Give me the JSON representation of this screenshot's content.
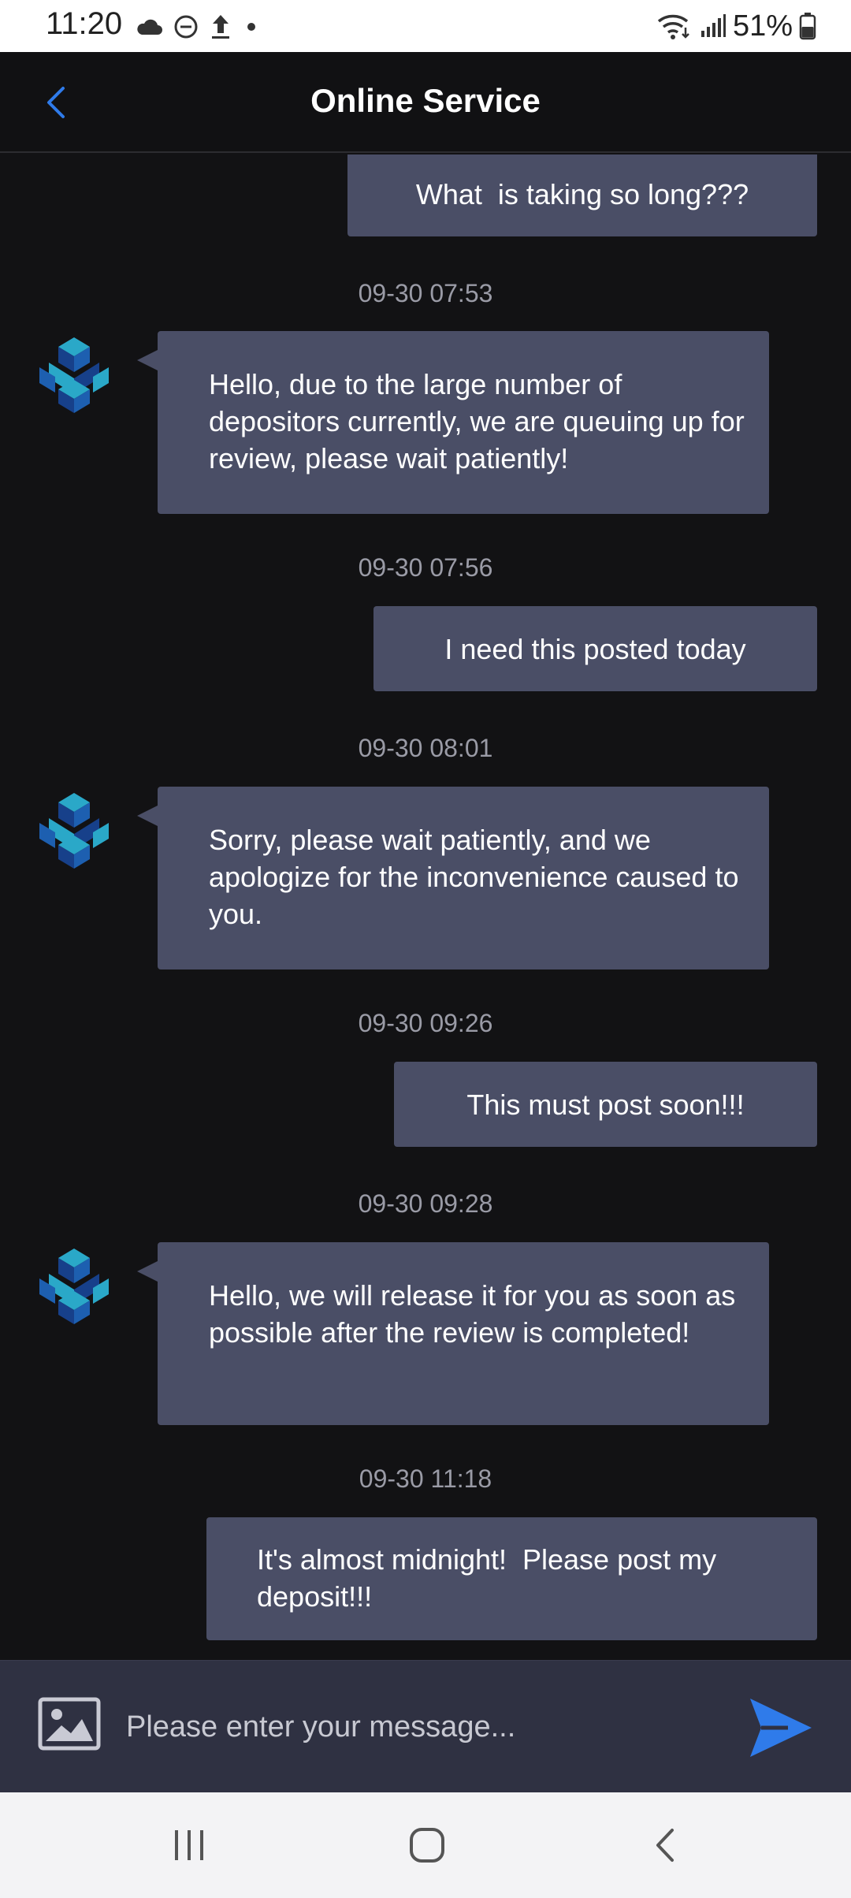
{
  "status_bar": {
    "time": "11:20",
    "battery": "51%",
    "icons_left": [
      "cloud-icon",
      "do-not-disturb-icon",
      "upload-icon",
      "dot-icon"
    ],
    "icons_right": [
      "wifi-icon",
      "signal-icon",
      "battery-icon"
    ]
  },
  "header": {
    "title": "Online Service",
    "back_icon": "chevron-left-icon",
    "accent": "#2f7bea"
  },
  "messages": [
    {
      "type": "outgoing",
      "text": "What  is taking so long???"
    },
    {
      "type": "timestamp",
      "text": "09-30 07:53"
    },
    {
      "type": "incoming",
      "text": "Hello, due to the large number of depositors currently, we are queuing up for review, please wait patiently!"
    },
    {
      "type": "timestamp",
      "text": "09-30 07:56"
    },
    {
      "type": "outgoing",
      "text": "I need this posted today"
    },
    {
      "type": "timestamp",
      "text": "09-30 08:01"
    },
    {
      "type": "incoming",
      "text": "Sorry, please wait patiently, and we apologize for the inconvenience caused to you."
    },
    {
      "type": "timestamp",
      "text": "09-30 09:26"
    },
    {
      "type": "outgoing",
      "text": "This must post soon!!!"
    },
    {
      "type": "timestamp",
      "text": "09-30 09:28"
    },
    {
      "type": "incoming",
      "text": "Hello, we will release it for you as soon as possible after the review is completed!"
    },
    {
      "type": "timestamp",
      "text": "09-30 11:18"
    },
    {
      "type": "outgoing",
      "text": "It's almost midnight!  Please post my deposit!!!"
    }
  ],
  "input": {
    "placeholder": "Please enter your message...",
    "value": "",
    "image_icon": "image-icon",
    "send_icon": "send-icon"
  },
  "nav_bar": {
    "icons": [
      "recent-apps-icon",
      "home-icon",
      "back-icon"
    ]
  },
  "colors": {
    "background": "#121214",
    "bubble": "#4a4e66",
    "input_bar": "#2f3142",
    "send": "#2f7bea"
  }
}
